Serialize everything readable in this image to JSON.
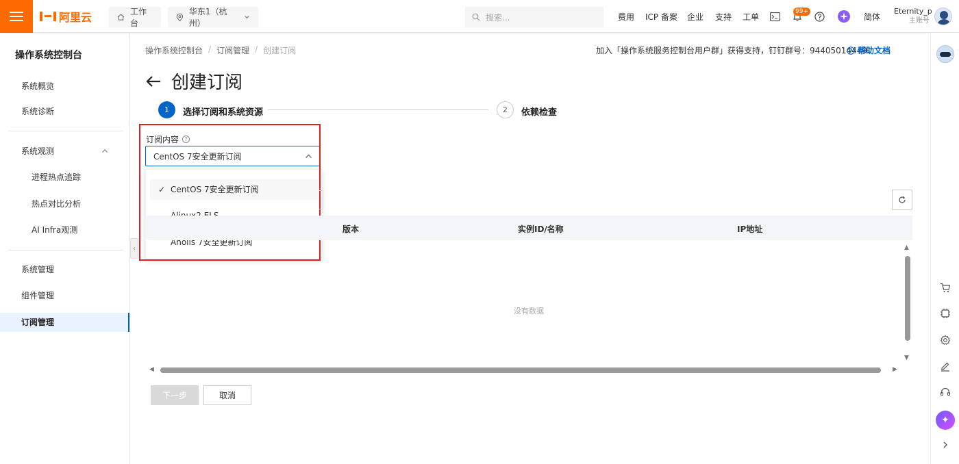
{
  "topbar": {
    "logo_text": "阿里云",
    "home_label": "工作台",
    "region_label": "华东1（杭州）",
    "search_placeholder": "搜索...",
    "nav": {
      "fee": "费用",
      "icp": "ICP 备案",
      "enterprise": "企业",
      "support": "支持",
      "ticket": "工单",
      "lang": "简体"
    },
    "bell_badge": "99+",
    "user_name": "Eternity_p",
    "user_role": "主账号",
    "brand_color": "#ff6a00"
  },
  "sidebar": {
    "title": "操作系统控制台",
    "items": [
      {
        "label": "系统概览"
      },
      {
        "label": "系统诊断"
      },
      {
        "label": "系统观测"
      },
      {
        "label": "进程热点追踪"
      },
      {
        "label": "热点对比分析"
      },
      {
        "label": "AI Infra观测"
      },
      {
        "label": "系统管理"
      },
      {
        "label": "组件管理"
      },
      {
        "label": "订阅管理"
      }
    ]
  },
  "breadcrumb": [
    "操作系统控制台",
    "订阅管理",
    "创建订阅"
  ],
  "notice": "加入「操作系统服务控制台用户群」获得支持，钉钉群号：94405014449",
  "help_doc": "帮助文档",
  "page_title": "创建订阅",
  "steps": [
    {
      "num": "1",
      "label": "选择订阅和系统资源"
    },
    {
      "num": "2",
      "label": "依赖检查"
    }
  ],
  "subscription": {
    "label": "订阅内容",
    "selected": "CentOS 7安全更新订阅",
    "options": [
      "CentOS 7安全更新订阅",
      "Alinux2 ELS",
      "Anolis 7安全更新订阅"
    ]
  },
  "table": {
    "columns": [
      "版本",
      "实例ID/名称",
      "IP地址"
    ],
    "empty_text": "没有数据"
  },
  "buttons": {
    "next": "下一步",
    "cancel": "取消"
  },
  "colors": {
    "primary": "#0064c8",
    "highlight_border": "#e02020"
  }
}
